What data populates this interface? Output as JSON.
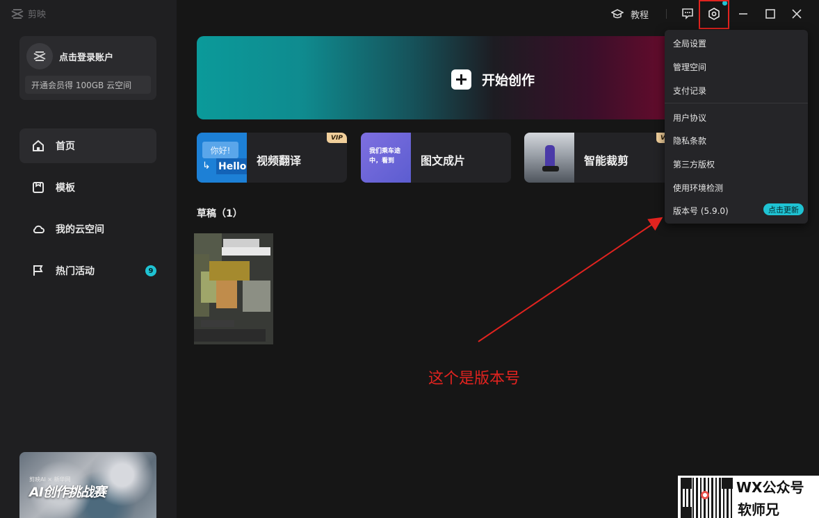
{
  "app": {
    "name": "剪映",
    "login_label": "点击登录账户",
    "vip_promo": "开通会员得 100GB 云空间"
  },
  "sidebar": {
    "items": [
      {
        "label": "首页",
        "active": true,
        "icon": "home-icon"
      },
      {
        "label": "模板",
        "active": false,
        "icon": "template-icon"
      },
      {
        "label": "我的云空间",
        "active": false,
        "icon": "cloud-icon"
      },
      {
        "label": "热门活动",
        "active": false,
        "icon": "flag-icon",
        "badge": "9"
      }
    ],
    "promo": {
      "subtitle": "剪映AI × 新华网",
      "title": "AI创作挑战赛"
    }
  },
  "topbar": {
    "tutorial_label": "教程",
    "icons": [
      "graduation-cap-icon",
      "feedback-icon",
      "settings-icon",
      "minimize-icon",
      "maximize-icon",
      "close-icon"
    ]
  },
  "hero": {
    "label": "开始创作"
  },
  "features": [
    {
      "label": "视频翻译",
      "vip": "VIP",
      "thumb_text_1": "你好!",
      "thumb_text_2": "Hello"
    },
    {
      "label": "图文成片",
      "thumb_text": "我们乘车途中，看到"
    },
    {
      "label": "智能裁剪",
      "vip": "VIP"
    }
  ],
  "drafts": {
    "title": "草稿（1）"
  },
  "settings_menu": {
    "items": [
      {
        "label": "全局设置"
      },
      {
        "label": "管理空间"
      },
      {
        "label": "支付记录"
      },
      {
        "label": "用户协议"
      },
      {
        "label": "隐私条款"
      },
      {
        "label": "第三方版权"
      },
      {
        "label": "使用环境检测"
      },
      {
        "label": "版本号 (5.9.0)"
      }
    ],
    "update_badge": "点击更新"
  },
  "annotation": {
    "text": "这个是版本号",
    "color": "#e1231f"
  },
  "watermark": {
    "line1": "WX公众号",
    "line2": "软师兄"
  },
  "colors": {
    "accent": "#1fc3d3",
    "background": "#161616",
    "sidebar": "#1f1f21",
    "highlight": "#e1231f"
  }
}
